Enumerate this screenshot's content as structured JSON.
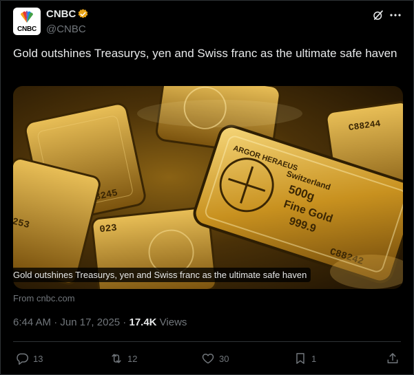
{
  "author": {
    "name": "CNBC",
    "handle": "@CNBC",
    "avatar_text": "CNBC",
    "verified_color": "#e8a317"
  },
  "post": {
    "text": "Gold outshines Treasurys, yen and Swiss franc as the ultimate safe haven"
  },
  "card": {
    "caption": "Gold outshines Treasurys, yen and Swiss franc as the ultimate safe haven",
    "source": "From cnbc.com",
    "bar_texts": [
      "ARGOR HERAEUS",
      "Switzerland",
      "500g",
      "Fine Gold",
      "999.9",
      "C88242",
      "88245",
      "C88244",
      "C88244",
      "023",
      "253"
    ]
  },
  "meta": {
    "time": "6:44 AM",
    "separator": " · ",
    "date": "Jun 17, 2025",
    "views_count": "17.4K",
    "views_label": " Views"
  },
  "actions": {
    "replies": "13",
    "reposts": "12",
    "likes": "30",
    "bookmarks": "1"
  },
  "colors": {
    "background": "#000000",
    "text": "#e7e9ea",
    "muted": "#71767b",
    "border": "#2f3336",
    "gold": "#d4a437"
  },
  "icons": [
    "grok-icon",
    "more-icon",
    "reply-icon",
    "repost-icon",
    "like-icon",
    "bookmark-icon",
    "share-icon",
    "verified-icon"
  ]
}
